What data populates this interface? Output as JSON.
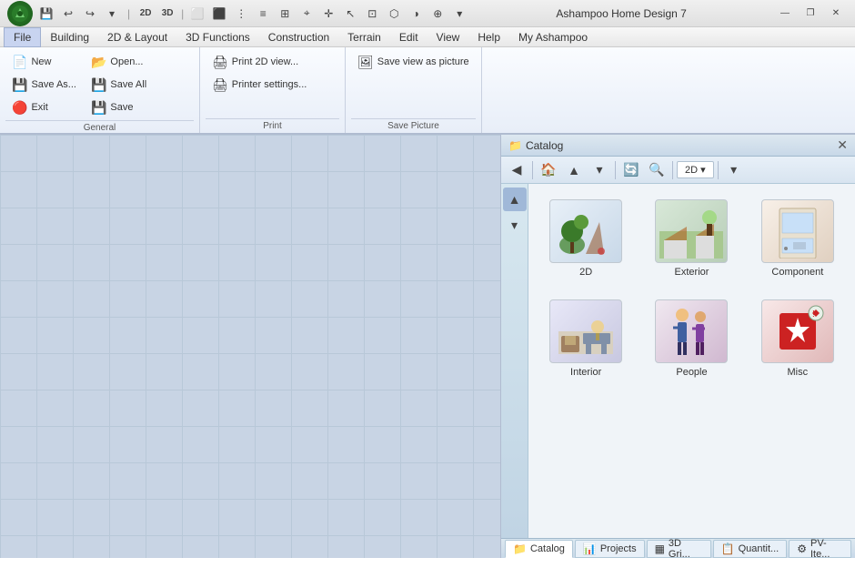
{
  "app": {
    "title": "Ashampoo Home Design 7"
  },
  "titlebar": {
    "quick_access": [
      "↩",
      "↪",
      "▾",
      "2D",
      "3D"
    ],
    "win_buttons": [
      "—",
      "❐",
      "✕"
    ]
  },
  "menubar": {
    "items": [
      {
        "label": "File",
        "active": true
      },
      {
        "label": "Building"
      },
      {
        "label": "2D & Layout"
      },
      {
        "label": "3D Functions"
      },
      {
        "label": "Construction"
      },
      {
        "label": "Terrain"
      },
      {
        "label": "Edit"
      },
      {
        "label": "View"
      },
      {
        "label": "Help"
      },
      {
        "label": "My Ashampoo"
      }
    ]
  },
  "ribbon": {
    "groups": [
      {
        "label": "General",
        "buttons": [
          {
            "id": "new",
            "label": "New",
            "icon": "📄"
          },
          {
            "id": "save-as",
            "label": "Save As...",
            "icon": "💾"
          },
          {
            "id": "exit",
            "label": "Exit",
            "icon": "🚪",
            "exit": true
          },
          {
            "id": "open",
            "label": "Open...",
            "icon": "📂"
          },
          {
            "id": "save-all",
            "label": "Save All",
            "icon": "💾"
          },
          {
            "id": "save",
            "label": "Save",
            "icon": "💾"
          }
        ]
      },
      {
        "label": "Print",
        "buttons": [
          {
            "id": "print-2d",
            "label": "Print 2D view...",
            "icon": "🖨"
          },
          {
            "id": "printer-settings",
            "label": "Printer settings...",
            "icon": "🖨"
          }
        ]
      },
      {
        "label": "Save Picture",
        "buttons": [
          {
            "id": "save-view",
            "label": "Save view as picture",
            "icon": "🖼"
          }
        ]
      }
    ]
  },
  "catalog": {
    "title": "Catalog",
    "toolbar_buttons": [
      "◀",
      "●",
      "▲",
      "▾",
      "2D ▾",
      "▾"
    ],
    "items": [
      {
        "id": "2d",
        "label": "2D",
        "emoji": "🌿"
      },
      {
        "id": "exterior",
        "label": "Exterior",
        "emoji": "🌳"
      },
      {
        "id": "component",
        "label": "Component",
        "emoji": "🚪"
      },
      {
        "id": "interior",
        "label": "Interior",
        "emoji": "🛋"
      },
      {
        "id": "people",
        "label": "People",
        "emoji": "🚶"
      },
      {
        "id": "misc",
        "label": "Misc",
        "emoji": "⛔"
      }
    ]
  },
  "bottom_tabs": [
    {
      "id": "catalog",
      "label": "Catalog",
      "icon": "📁",
      "active": true
    },
    {
      "id": "projects",
      "label": "Projects",
      "icon": "📊"
    },
    {
      "id": "3d-grid",
      "label": "3D Gri...",
      "icon": "▦"
    },
    {
      "id": "quantity",
      "label": "Quantit...",
      "icon": "📋"
    },
    {
      "id": "pv-items",
      "label": "PV-Ite...",
      "icon": "⚙"
    }
  ]
}
